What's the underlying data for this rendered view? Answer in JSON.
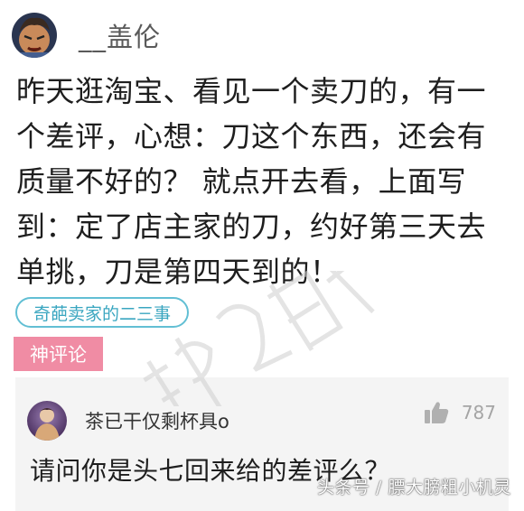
{
  "post": {
    "username": "__盖伦",
    "body": "昨天逛淘宝、看见一个卖刀的，有一个差评，心想：刀这个东西，还会有质量不好的？ 就点开去看，上面写到：定了店主家的刀，约好第三天去单挑，刀是第四天到的！",
    "topic_tag": "奇葩卖家的二三事"
  },
  "hot_comments": {
    "label": "神评论",
    "items": [
      {
        "username": "茶已干仅剩杯具o",
        "likes": "787",
        "text": "请问你是头七回来给的差评么？"
      }
    ]
  },
  "watermark": {
    "source": "头条号 / 膘大膀粗小机灵"
  },
  "colors": {
    "topic_border": "#62bfd4",
    "topic_text": "#3aa6c0",
    "hot_label_bg": "#f08ca4",
    "comment_bg": "#f4f4f4"
  },
  "icons": {
    "like": "thumbs-up-icon"
  }
}
